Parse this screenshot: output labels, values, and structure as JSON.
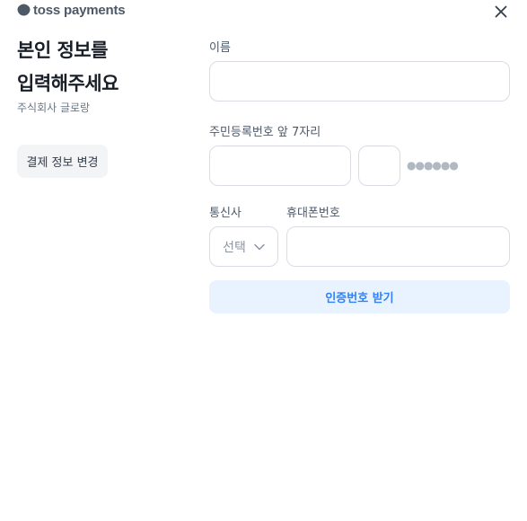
{
  "header": {
    "brand": "toss payments",
    "brand_icon": "toss-logo-icon",
    "close_icon": "close-icon"
  },
  "intro": {
    "title_line1": "본인 정보를",
    "title_line2": "입력해주세요",
    "merchant": "주식회사 글로랑",
    "change_payment_label": "결제 정보 변경"
  },
  "form": {
    "name_label": "이름",
    "name_value": "",
    "rrn_label": "주민등록번호 앞 7자리",
    "rrn_front_value": "",
    "rrn_back_first_value": "",
    "rrn_masked": "●●●●●●",
    "carrier_label": "통신사",
    "carrier_selected": "선택",
    "phone_label": "휴대폰번호",
    "phone_value": "",
    "verify_button_label": "인증번호 받기"
  },
  "colors": {
    "primary": "#3182f6",
    "primary_light": "#e8f3ff",
    "text": "#191f28",
    "muted": "#6b7684",
    "border": "#d9dde3"
  }
}
